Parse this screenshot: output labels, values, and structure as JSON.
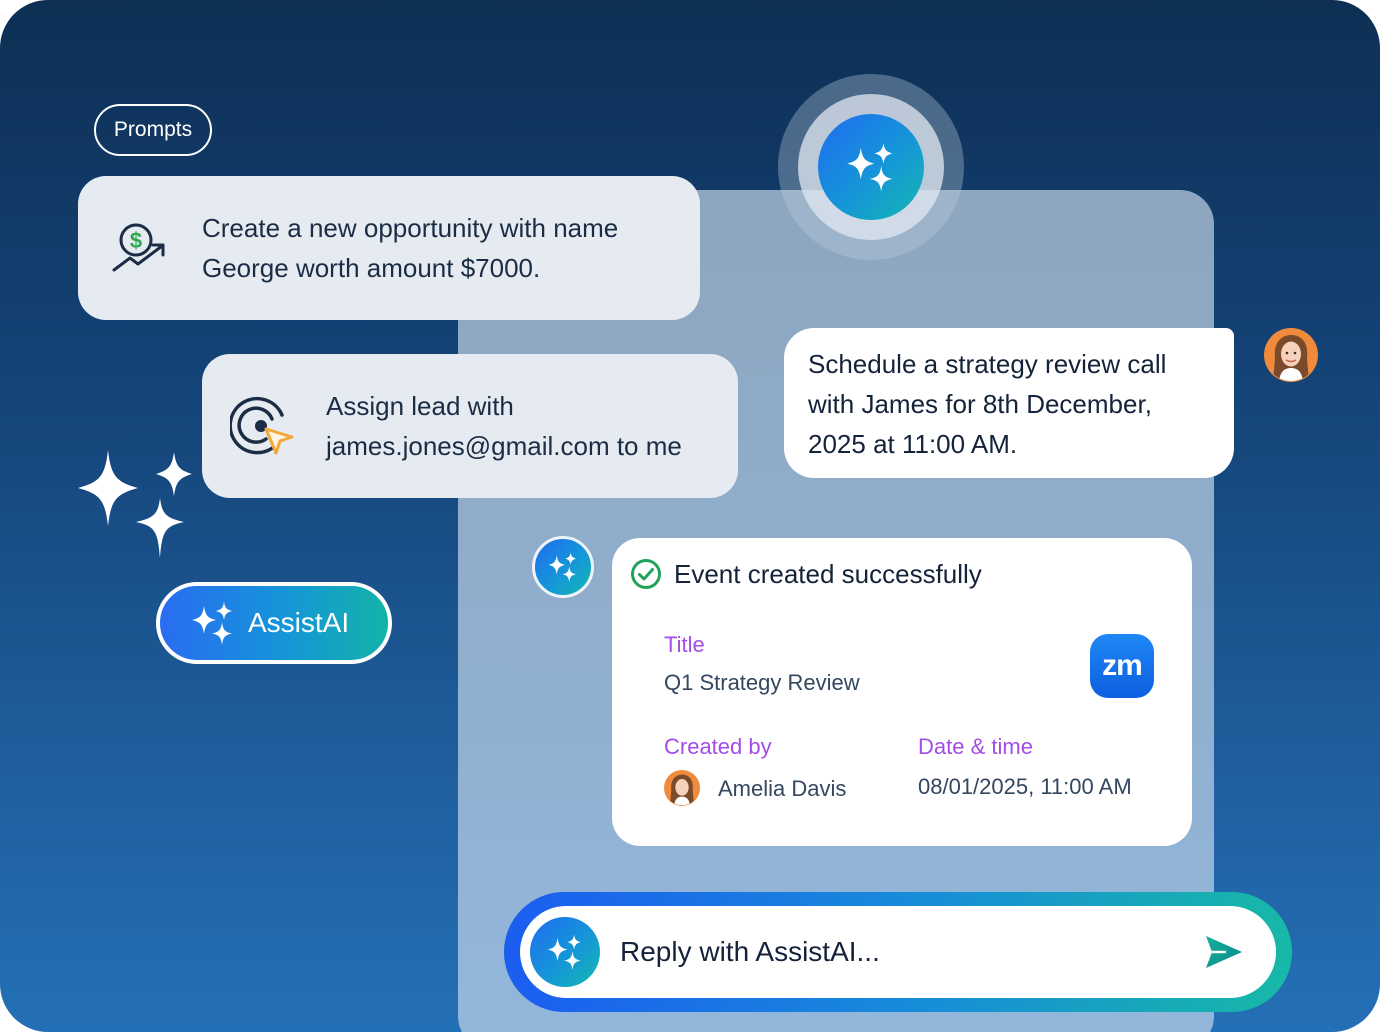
{
  "colors": {
    "background_top": "#0d2f54",
    "background_bottom": "#2470b6",
    "accent_gradient": [
      "#1f6cf0",
      "#1596d8",
      "#14b8b0"
    ],
    "field_label": "#a24ee6",
    "success": "#22a35a",
    "dollar_icon": "#2fa84f",
    "cursor_icon": "#f0a93a"
  },
  "prompts_chip": {
    "label": "Prompts"
  },
  "prompt_cards": [
    {
      "icon": "dollar-growth-icon",
      "text_line1": "Create a new opportunity with name",
      "text_line2": "George worth amount $7000."
    },
    {
      "icon": "target-cursor-icon",
      "text_line1": "Assign lead with",
      "text_line2": "james.jones@gmail.com to me"
    }
  ],
  "assist_button": {
    "label": "AssistAI",
    "icon": "sparkles-icon"
  },
  "chat": {
    "user_message": {
      "line1": "Schedule a strategy review call",
      "line2": "with James for 8th December,",
      "line3": "2025 at 11:00 AM."
    },
    "event_card": {
      "status": "Event created successfully",
      "title_label": "Title",
      "title_value": "Q1 Strategy Review",
      "app_badge": "zm",
      "created_by_label": "Created by",
      "created_by_value": "Amelia Davis",
      "datetime_label": "Date & time",
      "datetime_value": "08/01/2025, 11:00 AM"
    }
  },
  "reply_bar": {
    "placeholder": "Reply with AssistAI...",
    "send_icon": "send-icon"
  }
}
